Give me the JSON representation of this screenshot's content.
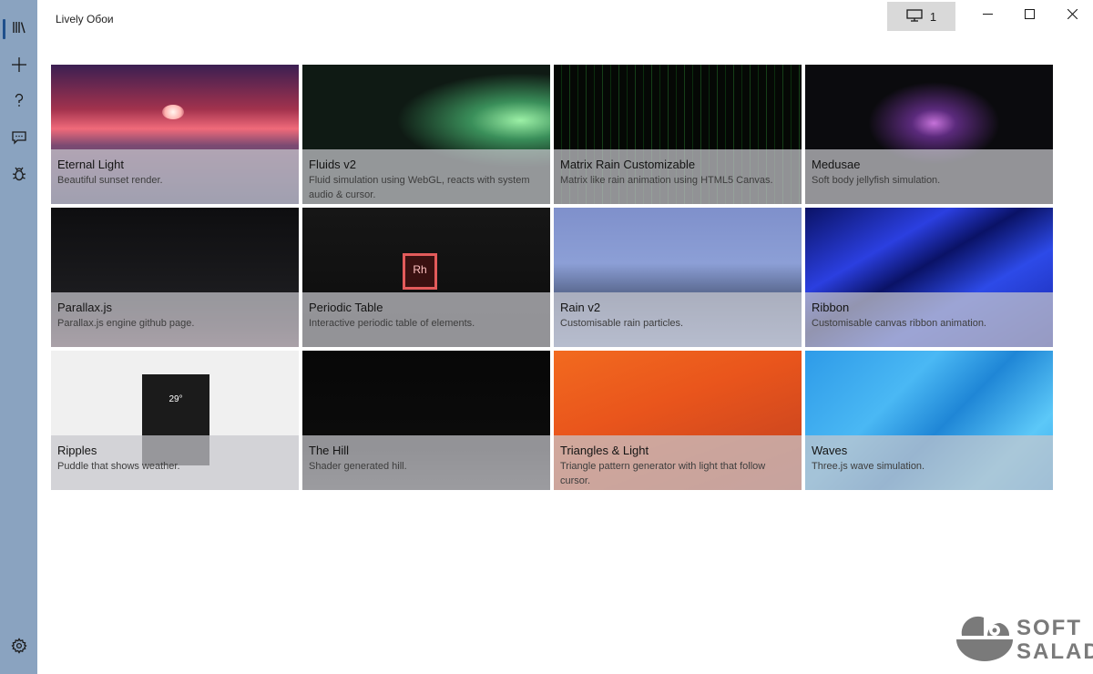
{
  "window": {
    "title": "Lively Обои",
    "monitor_count": "1"
  },
  "sidebar": {
    "items": [
      {
        "icon": "library-icon"
      },
      {
        "icon": "add-icon"
      },
      {
        "icon": "help-icon"
      },
      {
        "icon": "feedback-icon"
      },
      {
        "icon": "bug-icon"
      },
      {
        "icon": "settings-icon"
      }
    ]
  },
  "wallpapers": [
    {
      "title": "Eternal Light",
      "desc": "Beautiful sunset render."
    },
    {
      "title": "Fluids v2",
      "desc": "Fluid simulation using WebGL, reacts with system audio & cursor."
    },
    {
      "title": "Matrix Rain Customizable",
      "desc": "Matrix like rain animation using HTML5 Canvas."
    },
    {
      "title": "Medusae",
      "desc": "Soft body jellyfish simulation."
    },
    {
      "title": "Parallax.js",
      "desc": "Parallax.js engine github page."
    },
    {
      "title": "Periodic Table",
      "desc": "Interactive periodic table of elements."
    },
    {
      "title": "Rain v2",
      "desc": "Customisable rain particles."
    },
    {
      "title": "Ribbon",
      "desc": "Customisable canvas ribbon animation."
    },
    {
      "title": "Ripples",
      "desc": "Puddle that shows weather."
    },
    {
      "title": "The Hill",
      "desc": "Shader generated hill."
    },
    {
      "title": "Triangles & Light",
      "desc": "Triangle pattern generator with light that follow cursor."
    },
    {
      "title": "Waves",
      "desc": "Three.js wave simulation."
    }
  ],
  "periodic_cell": "Rh",
  "ripples_temp": "29°",
  "watermark": {
    "line1": "SOFT",
    "line2": "SALAD"
  }
}
